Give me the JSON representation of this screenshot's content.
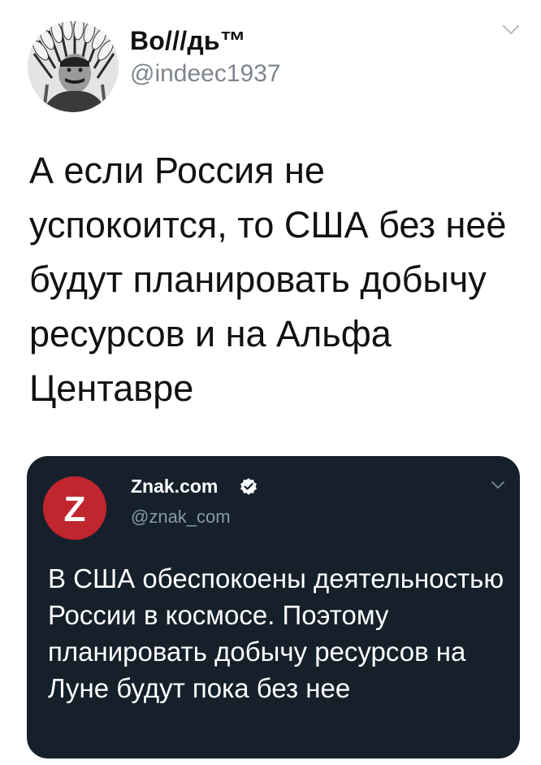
{
  "tweet": {
    "author_name": "Во///дь™",
    "author_handle": "@indeec1937",
    "text": "А если Россия не успокоится, то США без неё будут планировать добычу ресурсов и на Альфа Центавре"
  },
  "quoted_tweet": {
    "author_name": "Znak.com",
    "author_handle": "@znak_com",
    "avatar_letter": "Z",
    "text": "В США обеспокоены деятельностью России в космосе. Поэтому планировать добычу ресурсов на Луне будут пока без нее"
  },
  "colors": {
    "quote_background": "#15202b",
    "znak_brand": "#c0262e",
    "verified": "#ffffff"
  },
  "icons": {
    "tweet_menu": "chevron-down-icon",
    "quote_menu": "chevron-down-icon",
    "verified": "verified-badge-icon"
  }
}
